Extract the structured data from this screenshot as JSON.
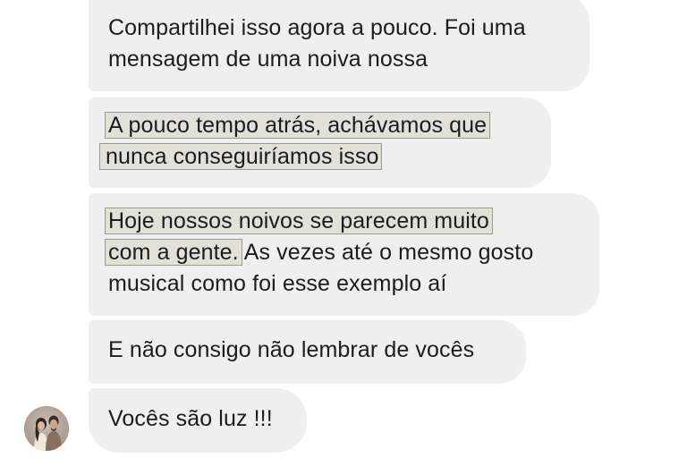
{
  "messages": [
    {
      "lines": [
        "Compartilhei isso agora a pouco. Foi uma",
        "mensagem de uma noiva nossa"
      ]
    },
    {
      "lines": [
        "A pouco tempo atrás, achávamos que",
        "nunca conseguiríamos isso"
      ]
    },
    {
      "line1": "Hoje nossos noivos se parecem muito",
      "line2_highlighted": "com a gente.",
      "line2_rest": "As vezes até o mesmo gosto",
      "line3": "musical como foi esse exemplo aí"
    },
    {
      "lines": [
        "E não consigo não lembrar de vocês"
      ]
    },
    {
      "lines": [
        "Vocês são luz !!!"
      ]
    }
  ],
  "colors": {
    "bubble_bg": "#efefef",
    "highlight_bg": "#e2e1d7",
    "highlight_border": "#9a9a8e",
    "text": "#1c1c1e"
  },
  "avatar": {
    "icon": "couple-photo-icon"
  }
}
